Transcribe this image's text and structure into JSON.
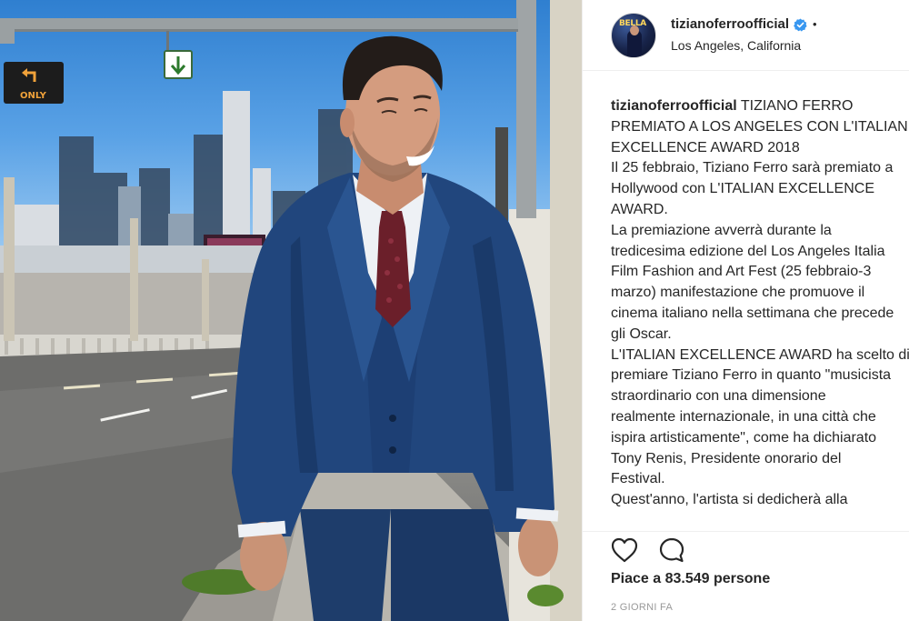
{
  "post": {
    "author": {
      "username": "tizianoferroofficial",
      "verified": true,
      "location": "Los Angeles, California",
      "separator": "•"
    },
    "caption": {
      "username": "tizianoferroofficial",
      "lines": [
        " TIZIANO FERRO",
        "PREMIATO A LOS ANGELES CON L'ITALIAN",
        "EXCELLENCE AWARD 2018",
        "Il 25 febbraio, Tiziano Ferro sarà premiato a",
        "Hollywood con L'ITALIAN EXCELLENCE",
        "AWARD.",
        "La premiazione avverrà durante la",
        "tredicesima edizione del Los Angeles Italia",
        "Film Fashion and Art Fest (25 febbraio-3",
        "marzo) manifestazione che promuove il",
        "cinema italiano nella settimana che precede",
        "gli Oscar.",
        "L'ITALIAN EXCELLENCE AWARD ha scelto di",
        "premiare Tiziano Ferro in quanto \"musicista",
        "straordinario con una dimensione",
        "realmente internazionale, in una città che",
        "ispira artisticamente\", come ha dichiarato",
        "Tony Renis, Presidente onorario del",
        "Festival.",
        "Quest'anno, l'artista si dedicherà alla"
      ]
    },
    "likes_text": "Piace a 83.549 persone",
    "timestamp": "2 GIORNI FA",
    "photo": {
      "sign_only": "ONLY",
      "avatar_sign": "BELLA"
    },
    "icons": {
      "like": "heart-outline-icon",
      "comment": "comment-bubble-icon",
      "verified": "verified-badge-icon"
    },
    "colors": {
      "verified": "#3897f0",
      "text": "#262626",
      "muted": "#999999"
    }
  }
}
